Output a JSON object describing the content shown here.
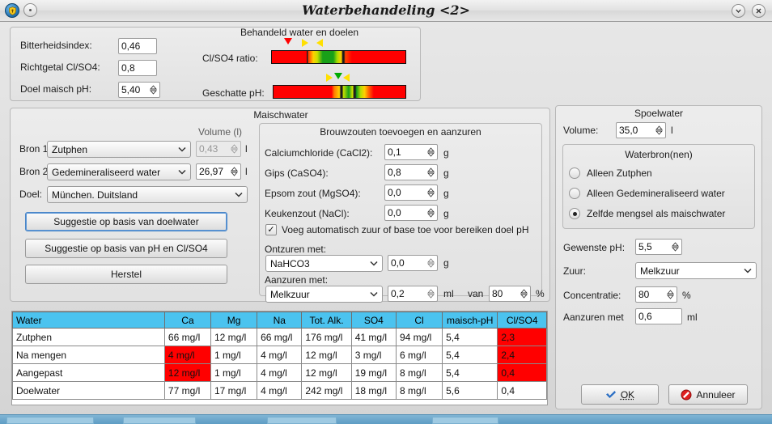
{
  "window": {
    "title": "Waterbehandeling <2>",
    "app_icon": "shield-icon",
    "menu_icon": "window-menu-icon",
    "minimize_icon": "chevron-down-icon",
    "close_icon": "close-icon"
  },
  "top_left": {
    "fields": [
      {
        "label": "Bitterheidsindex:",
        "value": "0,46",
        "type": "text"
      },
      {
        "label": "Richtgetal Cl/SO4:",
        "value": "0,8",
        "type": "text"
      },
      {
        "label": "Doel maisch pH:",
        "value": "5,40",
        "type": "spin"
      }
    ]
  },
  "treated": {
    "title": "Behandeld water en doelen",
    "bars": [
      {
        "label": "Cl/SO4 ratio:",
        "markers": [
          "red-down",
          "yellow-right",
          "yellow-left"
        ]
      },
      {
        "label": "Geschatte pH:",
        "markers": [
          "yellow-right",
          "green-down",
          "yellow-left"
        ]
      }
    ]
  },
  "mash": {
    "title": "Maischwater",
    "volume_header": "Volume (l)",
    "unit": "l",
    "sources": [
      {
        "label": "Bron 1:",
        "value": "Zutphen",
        "volume": "0,43",
        "disabled": true
      },
      {
        "label": "Bron 2:",
        "value": "Gedemineraliseerd water",
        "volume": "26,97",
        "disabled": false
      }
    ],
    "target": {
      "label": "Doel:",
      "value": "München. Duitsland"
    },
    "buttons": [
      "Suggestie op basis van doelwater",
      "Suggestie op basis van pH en Cl/SO4",
      "Herstel"
    ],
    "salts": {
      "title": "Brouwzouten toevoegen en aanzuren",
      "unit": "g",
      "rows": [
        {
          "label": "Calciumchloride (CaCl2):",
          "value": "0,1"
        },
        {
          "label": "Gips (CaSO4):",
          "value": "0,8"
        },
        {
          "label": "Epsom zout (MgSO4):",
          "value": "0,0"
        },
        {
          "label": "Keukenzout (NaCl):",
          "value": "0,0"
        }
      ],
      "auto_acid": {
        "checked": true,
        "label": "Voeg automatisch zuur of base toe voor bereiken doel pH"
      },
      "deacid": {
        "label": "Ontzuren met:",
        "agent": "NaHCO3",
        "amount": "0,0",
        "unit": "g"
      },
      "acid": {
        "label": "Aanzuren met:",
        "agent": "Melkzuur",
        "amount": "0,2",
        "unit": "ml",
        "van_label": "van",
        "concentration": "80",
        "pct": "%"
      }
    }
  },
  "sparge": {
    "title": "Spoelwater",
    "volume_label": "Volume:",
    "volume_value": "35,0",
    "volume_unit": "l",
    "sources_title": "Waterbron(nen)",
    "options": [
      {
        "label": "Alleen Zutphen",
        "selected": false
      },
      {
        "label": "Alleen Gedemineraliseerd water",
        "selected": false
      },
      {
        "label": "Zelfde mengsel als maischwater",
        "selected": true
      }
    ],
    "ph_label": "Gewenste pH:",
    "ph_value": "5,5",
    "acid_label": "Zuur:",
    "acid_value": "Melkzuur",
    "conc_label": "Concentratie:",
    "conc_value": "80",
    "conc_unit": "%",
    "add_label": "Aanzuren met",
    "add_value": "0,6",
    "add_unit": "ml"
  },
  "table": {
    "columns": [
      "Water",
      "Ca",
      "Mg",
      "Na",
      "Tot. Alk.",
      "SO4",
      "Cl",
      "maisch-pH",
      "Cl/SO4"
    ],
    "rows": [
      {
        "cells": [
          "Zutphen",
          "66 mg/l",
          "12 mg/l",
          "66 mg/l",
          "176 mg/l",
          "41 mg/l",
          "94 mg/l",
          "5,4",
          "2,3"
        ],
        "highlight": [
          false,
          false,
          false,
          false,
          false,
          false,
          false,
          false,
          true
        ]
      },
      {
        "cells": [
          "Na mengen",
          "4 mg/l",
          "1 mg/l",
          "4 mg/l",
          "12 mg/l",
          "3 mg/l",
          "6 mg/l",
          "5,4",
          "2,4"
        ],
        "highlight": [
          false,
          true,
          false,
          false,
          false,
          false,
          false,
          false,
          true
        ]
      },
      {
        "cells": [
          "Aangepast",
          "12 mg/l",
          "1 mg/l",
          "4 mg/l",
          "12 mg/l",
          "19 mg/l",
          "8 mg/l",
          "5,4",
          "0,4"
        ],
        "highlight": [
          false,
          true,
          false,
          false,
          false,
          false,
          false,
          false,
          true
        ]
      },
      {
        "cells": [
          "Doelwater",
          "77 mg/l",
          "17 mg/l",
          "4 mg/l",
          "242 mg/l",
          "18 mg/l",
          "8 mg/l",
          "5,6",
          "0,4"
        ],
        "highlight": [
          false,
          false,
          false,
          false,
          false,
          false,
          false,
          false,
          false
        ]
      }
    ]
  },
  "dialog_buttons": {
    "ok": "OK",
    "ok_icon": "check-icon",
    "cancel": "Annuleer",
    "cancel_icon": "forbidden-icon"
  },
  "colors": {
    "header": "#4bc3ef",
    "alert": "#ff0000",
    "focus": "#5e97d6"
  }
}
